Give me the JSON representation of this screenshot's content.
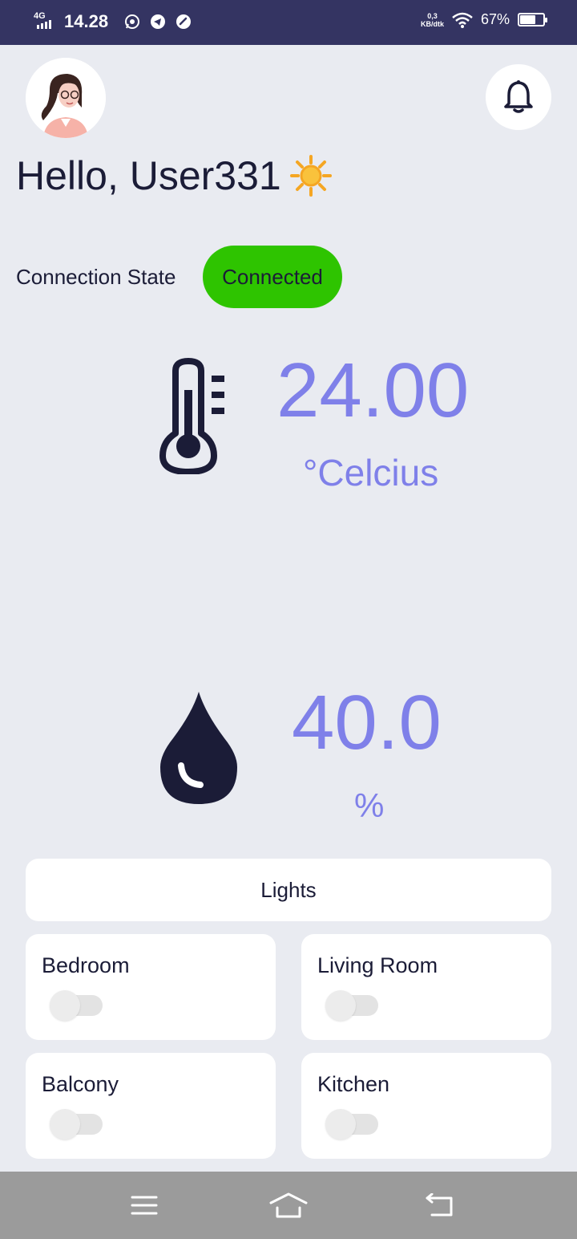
{
  "status_bar": {
    "network": "4G",
    "time": "14.28",
    "speed_value": "0,3",
    "speed_unit": "KB/dtk",
    "battery": "67%",
    "battery_level": 0.67,
    "app_icons": [
      "whatsapp-icon",
      "telegram-icon",
      "speed-check-icon"
    ]
  },
  "header": {
    "greeting": "Hello, User331"
  },
  "connection": {
    "label": "Connection State",
    "status": "Connected",
    "status_color": "#2ec400"
  },
  "temperature": {
    "value": "24.00",
    "unit": "°Celcius"
  },
  "humidity": {
    "value": "40.0",
    "unit": "%"
  },
  "lights": {
    "title": "Lights",
    "rooms": [
      {
        "label": "Bedroom",
        "on": false
      },
      {
        "label": "Living Room",
        "on": false
      },
      {
        "label": "Balcony",
        "on": false
      },
      {
        "label": "Kitchen",
        "on": false
      }
    ]
  },
  "colors": {
    "accent": "#7f80e9",
    "dark": "#1b1c37",
    "background": "#e9ebf1",
    "status_bar": "#343462"
  },
  "nav_bar": {
    "icons": [
      "menu-icon",
      "home-icon",
      "back-icon"
    ]
  }
}
